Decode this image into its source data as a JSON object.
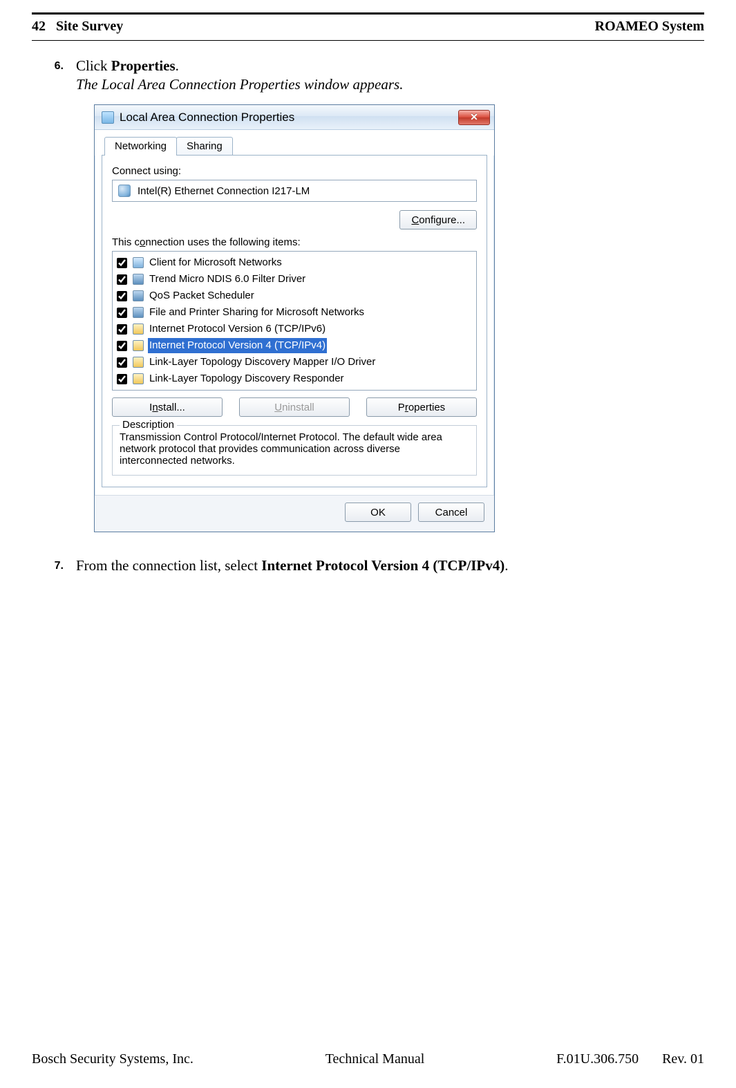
{
  "header": {
    "page_no": "42",
    "section": "Site Survey",
    "right": "ROAMEO System"
  },
  "steps": [
    {
      "num": "6.",
      "text_pre": "Click ",
      "text_bold": "Properties",
      "text_post": ".",
      "caption": "The Local Area Connection Properties window appears."
    },
    {
      "num": "7.",
      "text_pre": "From the connection list, select ",
      "text_bold": "Internet Protocol Version 4 (TCP/IPv4)",
      "text_post": "."
    }
  ],
  "dialog": {
    "title": "Local Area Connection Properties",
    "tabs": {
      "active": "Networking",
      "inactive": "Sharing"
    },
    "connect_label": "Connect using:",
    "adapter": "Intel(R) Ethernet Connection I217-LM",
    "configure_btn": "Configure...",
    "items_label": "This connection uses the following items:",
    "items": [
      {
        "label": "Client for Microsoft Networks",
        "icon": "ic-client",
        "selected": false
      },
      {
        "label": "Trend Micro NDIS 6.0 Filter Driver",
        "icon": "ic-service",
        "selected": false
      },
      {
        "label": "QoS Packet Scheduler",
        "icon": "ic-service",
        "selected": false
      },
      {
        "label": "File and Printer Sharing for Microsoft Networks",
        "icon": "ic-service",
        "selected": false
      },
      {
        "label": "Internet Protocol Version 6 (TCP/IPv6)",
        "icon": "ic-proto",
        "selected": false
      },
      {
        "label": "Internet Protocol Version 4 (TCP/IPv4)",
        "icon": "ic-proto",
        "selected": true
      },
      {
        "label": "Link-Layer Topology Discovery Mapper I/O Driver",
        "icon": "ic-proto",
        "selected": false
      },
      {
        "label": "Link-Layer Topology Discovery Responder",
        "icon": "ic-proto",
        "selected": false
      }
    ],
    "install_btn": "Install...",
    "uninstall_btn": "Uninstall",
    "properties_btn": "Properties",
    "desc_legend": "Description",
    "desc_text": "Transmission Control Protocol/Internet Protocol. The default wide area network protocol that provides communication across diverse interconnected networks.",
    "ok_btn": "OK",
    "cancel_btn": "Cancel",
    "close_glyph": "✕",
    "underlines": {
      "connection_o": "o",
      "install_n": "n",
      "uninstall_u": "U",
      "properties_r": "r",
      "configure_c": "C"
    }
  },
  "footer": {
    "left": "Bosch Security Systems, Inc.",
    "center": "Technical Manual",
    "docnum": "F.01U.306.750",
    "rev": "Rev. 01"
  }
}
